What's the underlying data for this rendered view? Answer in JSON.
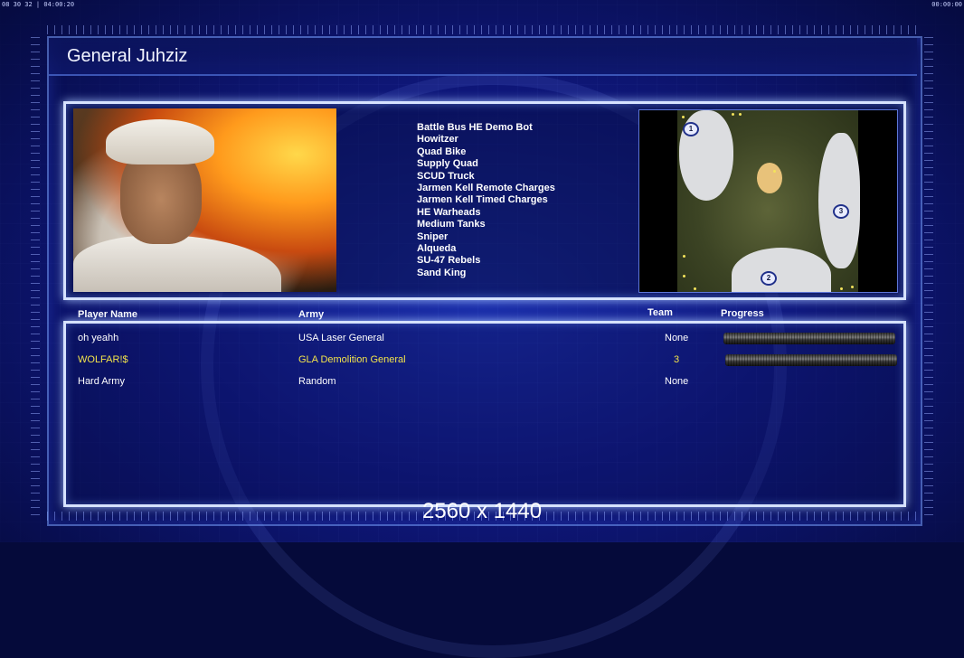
{
  "clock_left": "08 30 32 | 04:00:20",
  "clock_right": "00:00:00",
  "title": "General Juhziz",
  "units": [
    "Battle Bus HE Demo Bot",
    "Howitzer",
    "Quad Bike",
    "Supply Quad",
    "SCUD Truck",
    "Jarmen Kell Remote Charges",
    "Jarmen Kell Timed Charges",
    "HE Warheads",
    "Medium Tanks",
    "Sniper",
    "Alqueda",
    "SU-47 Rebels",
    "Sand King"
  ],
  "minimap": {
    "markers": [
      "1",
      "2",
      "3"
    ]
  },
  "columns": {
    "player": "Player Name",
    "army": "Army",
    "team": "Team",
    "progress": "Progress"
  },
  "players": [
    {
      "name": "oh yeahh",
      "army": "USA Laser General",
      "team": "None",
      "color": "#ffffff"
    },
    {
      "name": "WOLFAR!$",
      "army": "GLA Demolition General",
      "team": "3",
      "color": "#f2e34a"
    },
    {
      "name": "Hard Army",
      "army": "Random",
      "team": "None",
      "color": "#ffffff"
    }
  ],
  "resolution": "2560 x 1440"
}
